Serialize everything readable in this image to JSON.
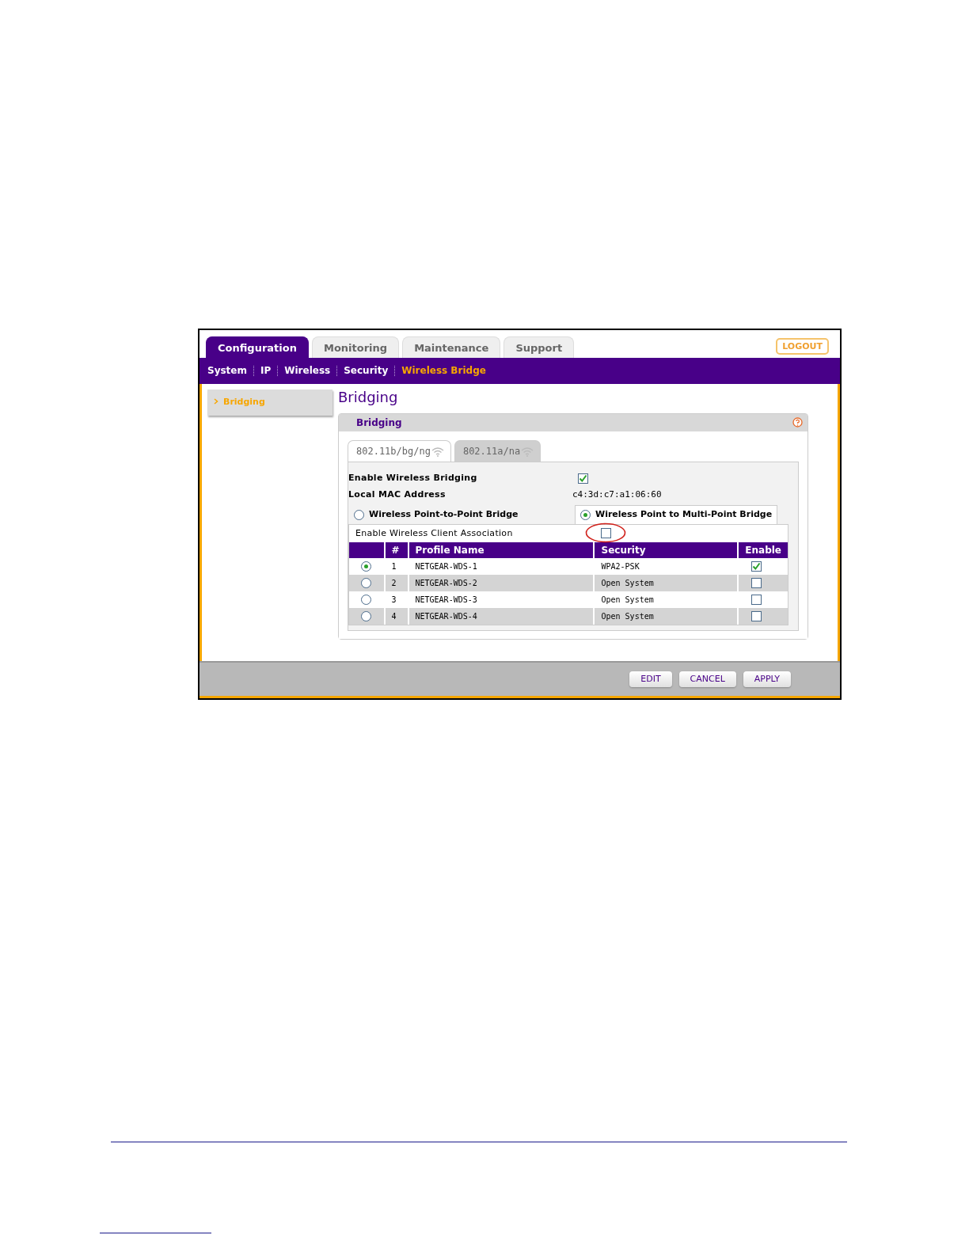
{
  "top_tabs": [
    {
      "label": "Configuration",
      "selected": true
    },
    {
      "label": "Monitoring",
      "selected": false
    },
    {
      "label": "Maintenance",
      "selected": false
    },
    {
      "label": "Support",
      "selected": false
    }
  ],
  "logout": "LOGOUT",
  "subnav": [
    {
      "label": "System",
      "selected": false
    },
    {
      "label": "IP",
      "selected": false
    },
    {
      "label": "Wireless",
      "selected": false
    },
    {
      "label": "Security",
      "selected": false
    },
    {
      "label": "Wireless Bridge",
      "selected": true
    }
  ],
  "sidebar": {
    "items": [
      {
        "label": "Bridging",
        "selected": true
      }
    ]
  },
  "heading": "Bridging",
  "panel": {
    "title": "Bridging",
    "band_tabs": [
      {
        "label": "802.11b/bg/ng",
        "selected": true
      },
      {
        "label": "802.11a/na",
        "selected": false
      }
    ],
    "enable_bridging": {
      "label": "Enable Wireless Bridging",
      "checked": true
    },
    "mac": {
      "label": "Local MAC Address",
      "value": "c4:3d:c7:a1:06:60"
    },
    "modes": [
      {
        "label": "Wireless Point-to-Point Bridge",
        "selected": false
      },
      {
        "label": "Wireless Point to Multi-Point Bridge",
        "selected": true
      }
    ],
    "client_association": {
      "label": "Enable Wireless Client Association",
      "checked": false,
      "highlighted": true
    },
    "table": {
      "columns": [
        "#",
        "Profile Name",
        "Security",
        "Enable"
      ],
      "rows": [
        {
          "selected": true,
          "number": "1",
          "profile": "NETGEAR-WDS-1",
          "security": "WPA2-PSK",
          "enabled": true
        },
        {
          "selected": false,
          "number": "2",
          "profile": "NETGEAR-WDS-2",
          "security": "Open System",
          "enabled": false
        },
        {
          "selected": false,
          "number": "3",
          "profile": "NETGEAR-WDS-3",
          "security": "Open System",
          "enabled": false
        },
        {
          "selected": false,
          "number": "4",
          "profile": "NETGEAR-WDS-4",
          "security": "Open System",
          "enabled": false
        }
      ]
    }
  },
  "buttons": [
    "EDIT",
    "CANCEL",
    "APPLY"
  ]
}
